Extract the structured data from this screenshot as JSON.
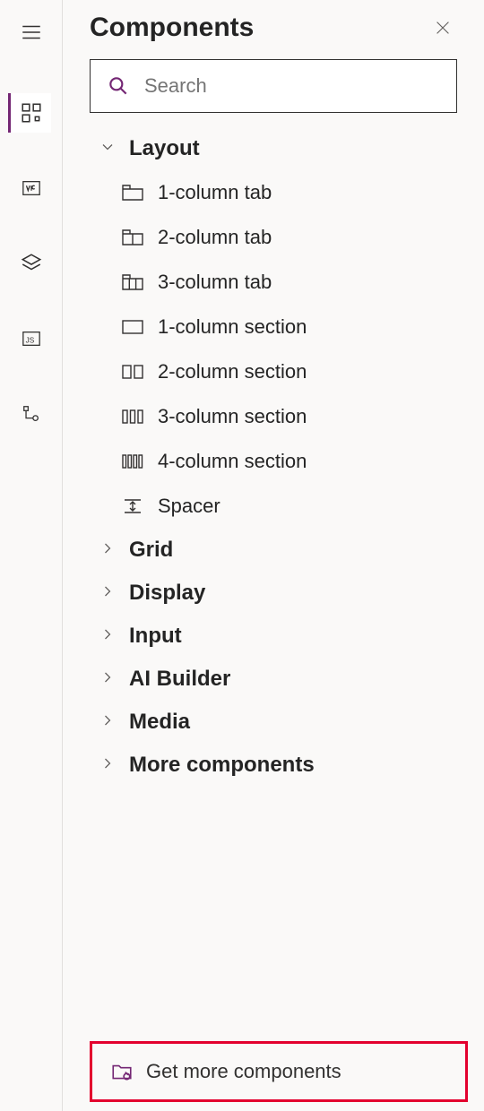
{
  "panel_title": "Components",
  "search_placeholder": "Search",
  "groups": {
    "layout": {
      "label": "Layout",
      "items": [
        {
          "label": "1-column tab"
        },
        {
          "label": "2-column tab"
        },
        {
          "label": "3-column tab"
        },
        {
          "label": "1-column section"
        },
        {
          "label": "2-column section"
        },
        {
          "label": "3-column section"
        },
        {
          "label": "4-column section"
        },
        {
          "label": "Spacer"
        }
      ]
    },
    "grid": {
      "label": "Grid"
    },
    "display": {
      "label": "Display"
    },
    "input": {
      "label": "Input"
    },
    "aibuilder": {
      "label": "AI Builder"
    },
    "media": {
      "label": "Media"
    },
    "more": {
      "label": "More components"
    }
  },
  "footer_button": "Get more components"
}
